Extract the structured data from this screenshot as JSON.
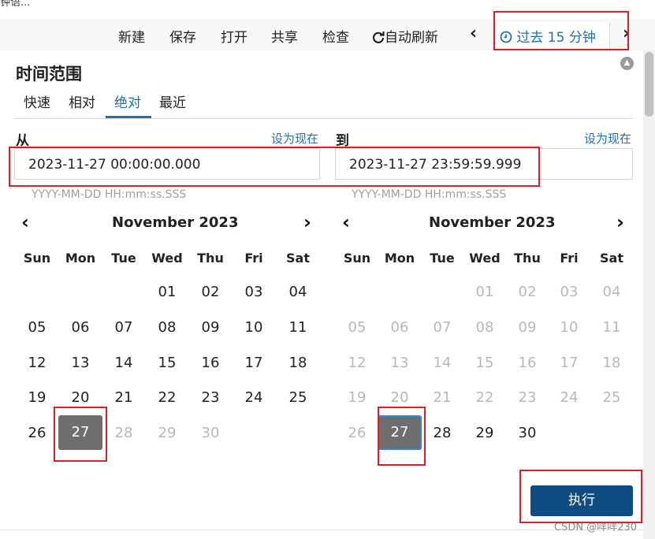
{
  "top_hint": "钟语...",
  "toolbar": {
    "items": [
      "新建",
      "保存",
      "打开",
      "共享",
      "检查"
    ],
    "refresh_label": "自动刷新",
    "time_label": "过去 15 分钟",
    "prev_label": "‹",
    "next_label": "›"
  },
  "panel": {
    "title": "时间范围",
    "tabs": [
      "快速",
      "相对",
      "绝对",
      "最近"
    ],
    "active_tab": "绝对"
  },
  "from": {
    "label": "从",
    "set_now": "设为现在",
    "value": "2023-11-27 00:00:00.000",
    "format": "YYYY-MM-DD HH:mm:ss.SSS"
  },
  "to": {
    "label": "到",
    "set_now": "设为现在",
    "value": "2023-11-27 23:59:59.999",
    "format": "YYYY-MM-DD HH:mm:ss.SSS"
  },
  "calendar_left": {
    "month": "November 2023",
    "weekdays": [
      "Sun",
      "Mon",
      "Tue",
      "Wed",
      "Thu",
      "Fri",
      "Sat"
    ],
    "weeks": [
      [
        "",
        "",
        "",
        "01",
        "02",
        "03",
        "04"
      ],
      [
        "05",
        "06",
        "07",
        "08",
        "09",
        "10",
        "11"
      ],
      [
        "12",
        "13",
        "14",
        "15",
        "16",
        "17",
        "18"
      ],
      [
        "19",
        "20",
        "21",
        "22",
        "23",
        "24",
        "25"
      ],
      [
        "26",
        "27",
        "28",
        "29",
        "30",
        "",
        ""
      ]
    ],
    "selected": "27",
    "muted_after_selected": true
  },
  "calendar_right": {
    "month": "November 2023",
    "weekdays": [
      "Sun",
      "Mon",
      "Tue",
      "Wed",
      "Thu",
      "Fri",
      "Sat"
    ],
    "weeks": [
      [
        "",
        "",
        "",
        "01",
        "02",
        "03",
        "04"
      ],
      [
        "05",
        "06",
        "07",
        "08",
        "09",
        "10",
        "11"
      ],
      [
        "12",
        "13",
        "14",
        "15",
        "16",
        "17",
        "18"
      ],
      [
        "19",
        "20",
        "21",
        "22",
        "23",
        "24",
        "25"
      ],
      [
        "26",
        "27",
        "28",
        "29",
        "30",
        "",
        ""
      ]
    ],
    "selected": "27",
    "muted_before_selected": true
  },
  "run_button": "执行",
  "watermark": "CSDN @咩咩230"
}
